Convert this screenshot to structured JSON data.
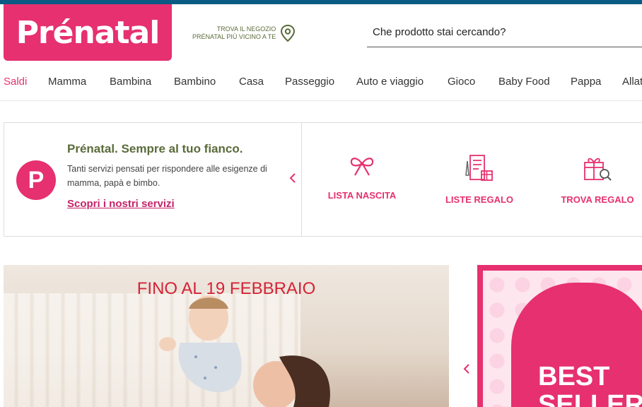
{
  "brand": {
    "name": "Prénatal"
  },
  "store_locator": {
    "line1": "TROVA IL NEGOZIO",
    "line2": "PRÉNATAL PIÙ VICINO A TE"
  },
  "search": {
    "placeholder": "Che prodotto stai cercando?"
  },
  "nav": [
    {
      "label": "Saldi"
    },
    {
      "label": "Mamma"
    },
    {
      "label": "Bambina"
    },
    {
      "label": "Bambino"
    },
    {
      "label": "Casa"
    },
    {
      "label": "Passeggio"
    },
    {
      "label": "Auto e viaggio"
    },
    {
      "label": "Gioco"
    },
    {
      "label": "Baby Food"
    },
    {
      "label": "Pappa"
    },
    {
      "label": "Allat"
    }
  ],
  "services": {
    "badge": "P",
    "title": "Prénatal. Sempre al tuo fianco.",
    "description": "Tanti servizi pensati per rispondere alle esigenze di mamma, papà e bimbo.",
    "link": "Scopri i nostri servizi",
    "features": [
      {
        "label": "LISTA NASCITA",
        "icon": "bow-icon"
      },
      {
        "label": "LISTE REGALO",
        "icon": "list-gift-icon"
      },
      {
        "label": "TROVA REGALO",
        "icon": "gift-search-icon"
      }
    ]
  },
  "hero": {
    "title": "FINO AL 19 FEBBRAIO"
  },
  "promo": {
    "line1": "BEST",
    "line2": "SELLER"
  },
  "colors": {
    "brand_pink": "#e6306f",
    "olive": "#5a6b3a",
    "top_bar": "#0b5a84"
  }
}
